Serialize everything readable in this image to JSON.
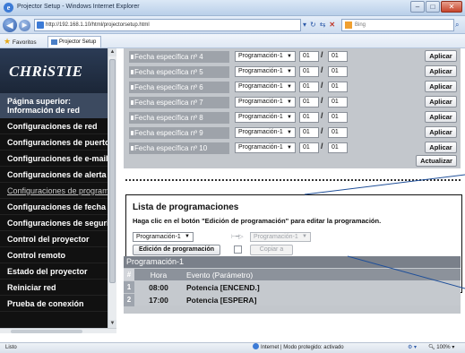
{
  "window": {
    "title": "Projector Setup - Windows Internet Explorer",
    "minimize": "–",
    "maximize": "□",
    "close": "✕"
  },
  "addressbar": {
    "url": "http://192.168.1.10/html/projectorsetup.html",
    "search_placeholder": "Bing"
  },
  "favorites": {
    "label": "Favoritos",
    "tab_title": "Projector Setup"
  },
  "sidebar": {
    "logo": "CHRiSTIE",
    "top_link": "Página superior: Información de red",
    "items": [
      {
        "label": "Configuraciones de red"
      },
      {
        "label": "Configuraciones de puerto"
      },
      {
        "label": "Configuraciones de e-mail"
      },
      {
        "label": "Configuraciones de alerta"
      },
      {
        "label": "Configuraciones de programación",
        "current": true
      },
      {
        "label": "Configuraciones de fecha"
      },
      {
        "label": "Configuraciones de seguridad"
      },
      {
        "label": "Control del proyector"
      },
      {
        "label": "Control remoto"
      },
      {
        "label": "Estado del proyector"
      },
      {
        "label": "Reiniciar red"
      },
      {
        "label": "Prueba de conexión"
      }
    ]
  },
  "date_rows": [
    {
      "label": "Fecha específica nº 4",
      "program": "Programación-1",
      "month": "01",
      "day": "01",
      "apply": "Aplicar"
    },
    {
      "label": "Fecha específica nº 5",
      "program": "Programación-1",
      "month": "01",
      "day": "01",
      "apply": "Aplicar"
    },
    {
      "label": "Fecha específica nº 6",
      "program": "Programación-1",
      "month": "01",
      "day": "01",
      "apply": "Aplicar"
    },
    {
      "label": "Fecha específica nº 7",
      "program": "Programación-1",
      "month": "01",
      "day": "01",
      "apply": "Aplicar"
    },
    {
      "label": "Fecha específica nº 8",
      "program": "Programación-1",
      "month": "01",
      "day": "01",
      "apply": "Aplicar"
    },
    {
      "label": "Fecha específica nº 9",
      "program": "Programación-1",
      "month": "01",
      "day": "01",
      "apply": "Aplicar"
    },
    {
      "label": "Fecha específica nº 10",
      "program": "Programación-1",
      "month": "01",
      "day": "01",
      "apply": "Aplicar"
    }
  ],
  "update_button": "Actualizar",
  "schedule_list": {
    "title": "Lista de programaciones",
    "instruction": "Haga clic en el botón \"Edición de programación\" para editar la programación.",
    "selected_program": "Programación-1",
    "copy_target": "Programación-1",
    "edit_button": "Edición de programación",
    "copy_button": "Copiar a"
  },
  "schedule_table": {
    "title": "Programación-1",
    "columns": [
      "#",
      "Hora",
      "Evento (Parámetro)"
    ],
    "rows": [
      {
        "num": "1",
        "time": "08:00",
        "event": "Potencia [ENCEND.]"
      },
      {
        "num": "2",
        "time": "17:00",
        "event": "Potencia [ESPERA]"
      }
    ]
  },
  "statusbar": {
    "left": "Listo",
    "zone": "Internet | Modo protegido: activado",
    "zoom": "100%"
  }
}
